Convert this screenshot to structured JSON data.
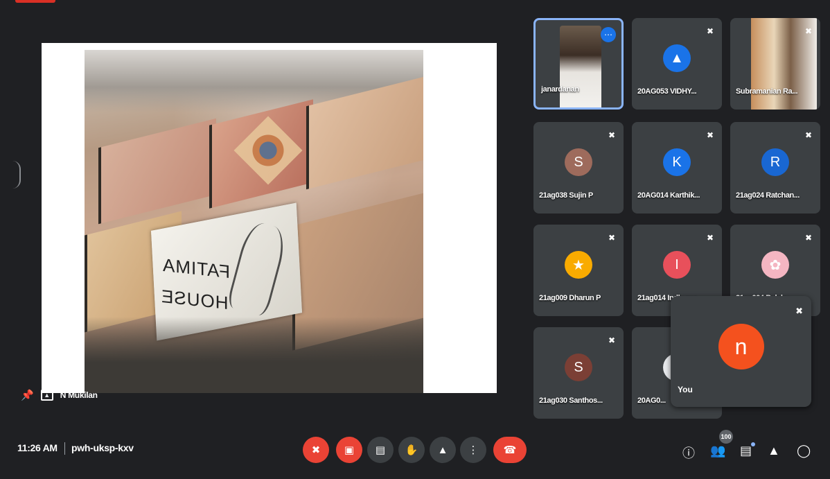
{
  "presentation": {
    "sign_line1": "FATIMA",
    "sign_line2": "HOUSE",
    "presenter_name": "N Mukilan"
  },
  "participants": [
    {
      "label": "janardanan",
      "type": "video",
      "active": true
    },
    {
      "label": "20AG053 VIDHY...",
      "type": "avatar-image",
      "color": "#1a73e8"
    },
    {
      "label": "Subramanian Ra...",
      "type": "video"
    },
    {
      "label": "21ag038 Sujin P",
      "initial": "S",
      "color": "#9e6b5c"
    },
    {
      "label": "20AG014 Karthik...",
      "initial": "K",
      "color": "#1a73e8"
    },
    {
      "label": "21ag024 Ratchan...",
      "initial": "R",
      "color": "#1967d2"
    },
    {
      "label": "21ag009 Dharun P",
      "type": "avatar-image",
      "color": "#f9ab00"
    },
    {
      "label": "21ag014 Indhuma...",
      "initial": "I",
      "color": "#e8505b"
    },
    {
      "label": "21ag004 Balaku...",
      "type": "avatar-image",
      "color": "#f4b6c2"
    },
    {
      "label": "21ag030 Santhos...",
      "initial": "S",
      "color": "#7b3f35"
    },
    {
      "label": "20AG0...",
      "initial": "",
      "color": "#e8eaed"
    }
  ],
  "self_view": {
    "label": "You",
    "initial": "n",
    "color": "#f4511e"
  },
  "meeting": {
    "time": "11:26 AM",
    "code": "pwh-uksp-kxv",
    "people_count": "100"
  }
}
